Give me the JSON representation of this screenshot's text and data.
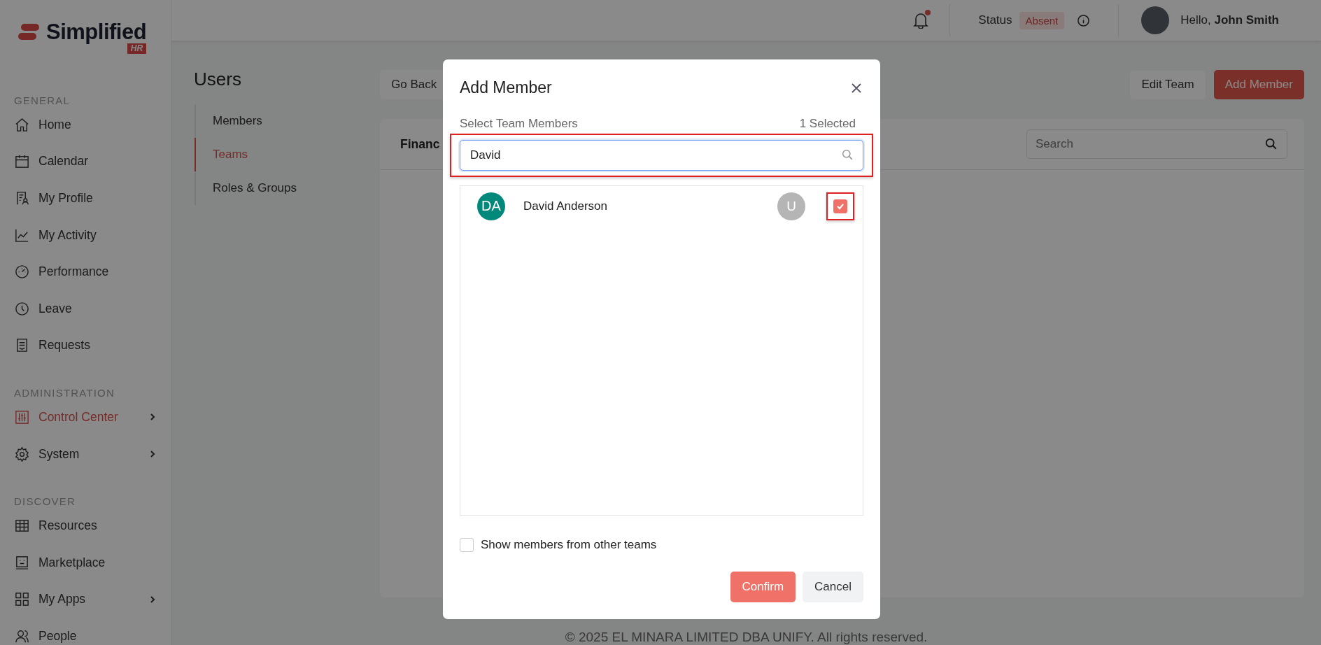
{
  "sidebar": {
    "logo": {
      "text": "Simplified",
      "badge": "HR"
    },
    "sections": [
      {
        "heading": "GENERAL",
        "items": [
          {
            "label": "Home",
            "selected": false,
            "submenu": false
          },
          {
            "label": "Calendar",
            "selected": false,
            "submenu": false
          },
          {
            "label": "My Profile",
            "selected": false,
            "submenu": false
          },
          {
            "label": "My Activity",
            "selected": false,
            "submenu": false
          },
          {
            "label": "Performance",
            "selected": false,
            "submenu": false
          },
          {
            "label": "Leave",
            "selected": false,
            "submenu": false
          },
          {
            "label": "Requests",
            "selected": false,
            "submenu": false
          }
        ]
      },
      {
        "heading": "ADMINISTRATION",
        "items": [
          {
            "label": "Control Center",
            "selected": true,
            "submenu": true
          },
          {
            "label": "System",
            "selected": false,
            "submenu": true
          }
        ]
      },
      {
        "heading": "DISCOVER",
        "items": [
          {
            "label": "Resources",
            "selected": false,
            "submenu": false
          },
          {
            "label": "Marketplace",
            "selected": false,
            "submenu": false
          },
          {
            "label": "My Apps",
            "selected": false,
            "submenu": true
          },
          {
            "label": "People",
            "selected": false,
            "submenu": false
          }
        ]
      }
    ]
  },
  "topbar": {
    "notification": true,
    "status_label": "Status",
    "status": "Absent",
    "greeting": "Hello,",
    "user_name": "John Smith"
  },
  "page": {
    "title": "Users",
    "subnav": [
      {
        "label": "Members",
        "selected": false
      },
      {
        "label": "Teams",
        "selected": true
      },
      {
        "label": "Roles & Groups",
        "selected": false
      }
    ],
    "go_back": "Go Back",
    "edit_button": "Edit Team",
    "add_button": "Add Member",
    "card_title": "Financ",
    "search": {
      "placeholder": "Search"
    }
  },
  "modal": {
    "title": "Add Member",
    "subtitle": "Select Team Members",
    "selected_count": "1 Selected",
    "search": {
      "value": "David",
      "highlighted": true
    },
    "members": [
      {
        "initials": "DA",
        "name": "David Anderson",
        "color": "#00897b",
        "role_badge": "U",
        "checked": true,
        "highlighted": true
      }
    ],
    "show_other_teams": {
      "label": "Show members from other teams",
      "checked": false
    },
    "confirm": "Confirm",
    "cancel": "Cancel"
  },
  "footer": "© 2025 EL MINARA LIMITED DBA UNIFY. All rights reserved."
}
